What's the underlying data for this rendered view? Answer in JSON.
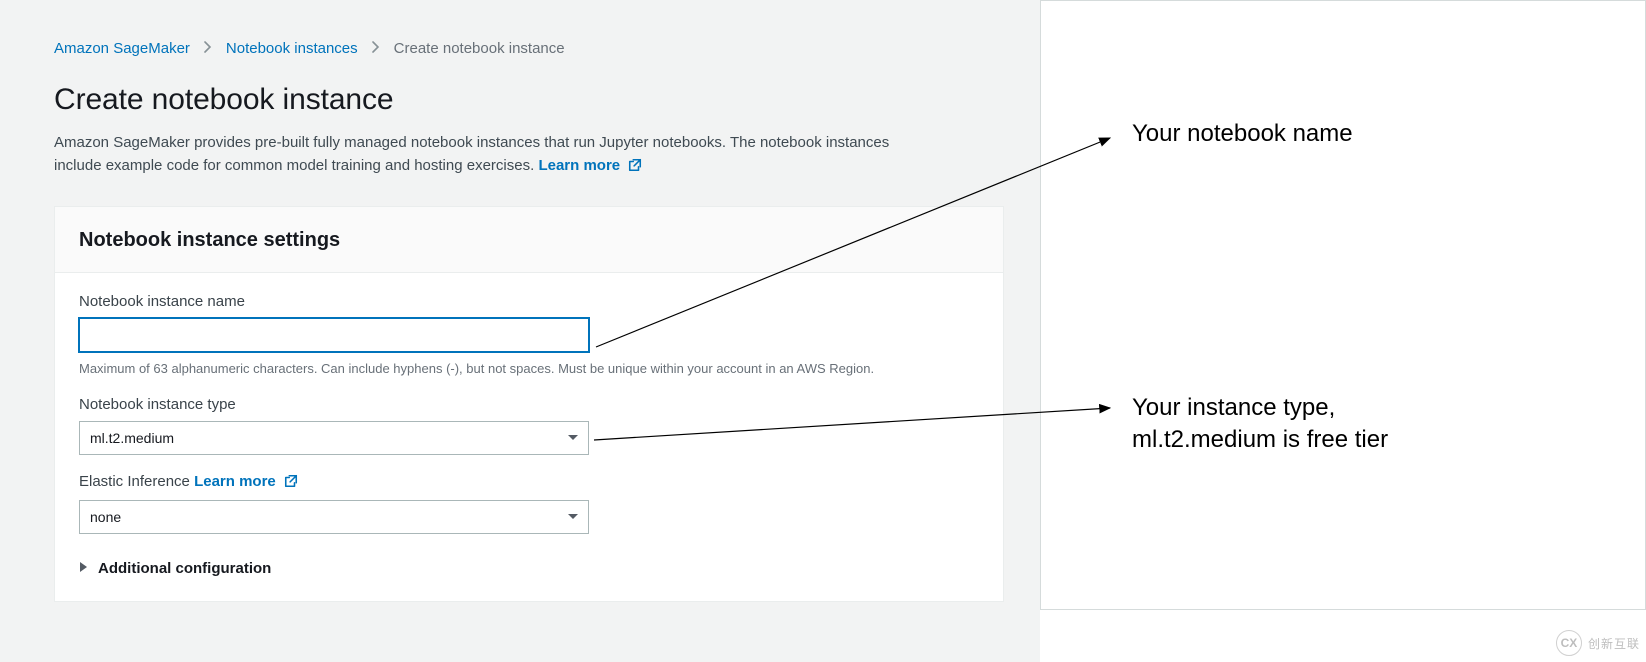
{
  "breadcrumb": {
    "items": [
      {
        "label": "Amazon SageMaker"
      },
      {
        "label": "Notebook instances"
      },
      {
        "label": "Create notebook instance"
      }
    ]
  },
  "page": {
    "title": "Create notebook instance",
    "description": "Amazon SageMaker provides pre-built fully managed notebook instances that run Jupyter notebooks. The notebook instances include example code for common model training and hosting exercises.",
    "learn_more": "Learn more"
  },
  "card": {
    "title": "Notebook instance settings",
    "name_field": {
      "label": "Notebook instance name",
      "value": "",
      "help": "Maximum of 63 alphanumeric characters. Can include hyphens (-), but not spaces. Must be unique within your account in an AWS Region."
    },
    "type_field": {
      "label": "Notebook instance type",
      "value": "ml.t2.medium"
    },
    "elastic_field": {
      "label": "Elastic Inference",
      "learn_more": "Learn more",
      "value": "none"
    },
    "additional": {
      "label": "Additional configuration"
    }
  },
  "annotations": {
    "name": "Your notebook name",
    "type_line1": "Your instance type,",
    "type_line2": "ml.t2.medium is free tier"
  },
  "watermark": {
    "text": "创新互联",
    "badge": "CX"
  }
}
